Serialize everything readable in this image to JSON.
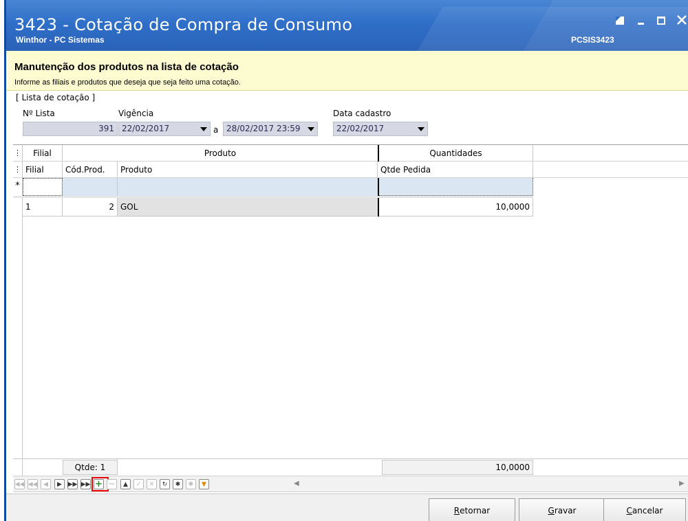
{
  "window": {
    "title": "3423 - Cotação de Compra de Consumo",
    "subtitle": "Winthor - PC Sistemas",
    "code": "PCSIS3423"
  },
  "header": {
    "title": "Manutenção dos produtos na lista de cotação",
    "description": "Informe as filiais e produtos que deseja que seja feito uma cotação."
  },
  "group": {
    "title": "[ Lista de cotação ]",
    "numero_label": "Nº Lista",
    "numero_value": "391",
    "vigencia_label": "Vigência",
    "vigencia_inicio": "22/02/2017",
    "vigencia_sep": "a",
    "vigencia_fim": "28/02/2017 23:59",
    "data_cadastro_label": "Data cadastro",
    "data_cadastro_value": "22/02/2017"
  },
  "grid": {
    "bands": [
      "Filial",
      "Produto",
      "Quantidades"
    ],
    "columns": [
      "Filial",
      "Cód.Prod.",
      "Produto",
      "Qtde Pedida"
    ],
    "new_row_marker": "*",
    "rows": [
      {
        "filial": "1",
        "cod": "2",
        "produto": "GOL",
        "qtde": "10,0000"
      }
    ],
    "footer_count": "Qtde: 1",
    "footer_total": "10,0000"
  },
  "buttons": {
    "retornar": "Retornar",
    "retornar_key": "R",
    "retornar_rest": "etornar",
    "gravar_key": "G",
    "gravar_rest": "ravar",
    "cancelar_key": "C",
    "cancelar_rest": "ancelar"
  }
}
